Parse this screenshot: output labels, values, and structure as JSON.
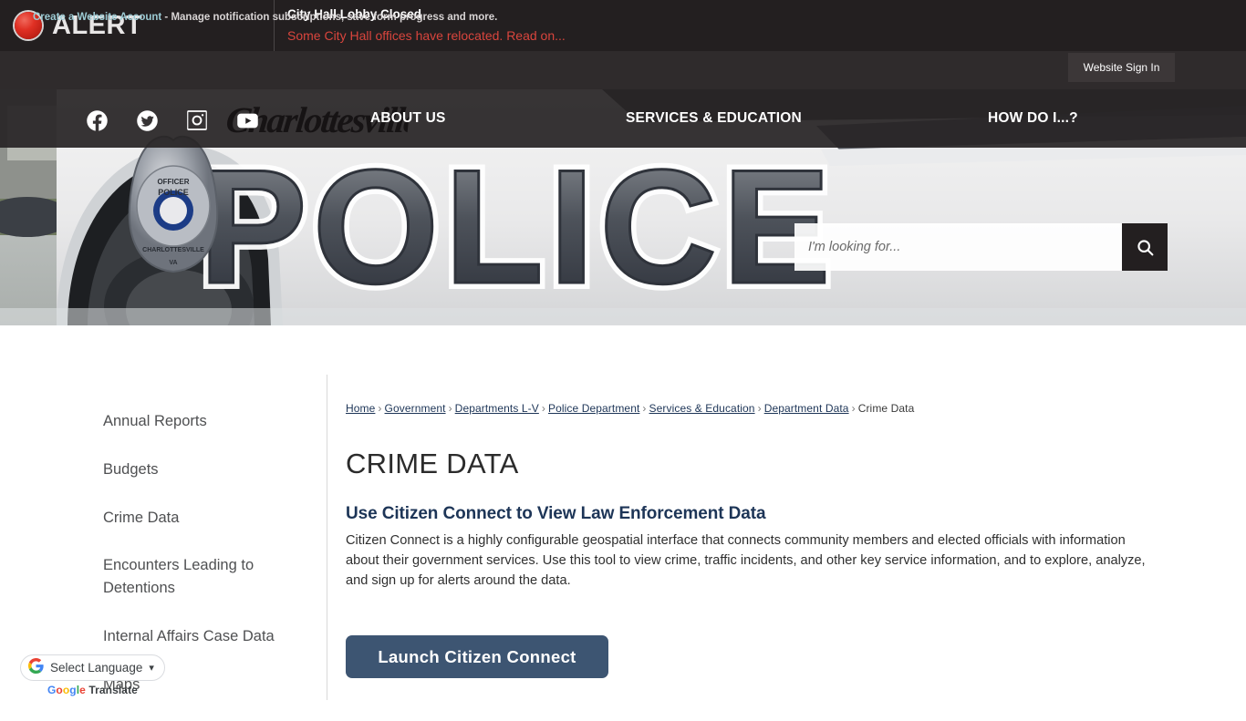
{
  "alert": {
    "badge_label": "ALERT",
    "title": "City Hall Lobby Closed",
    "link": "Some City Hall offices have relocated. Read on..."
  },
  "account_bar": {
    "link_label": "Create a Website Account",
    "description": " - Manage notification subscriptions, save form progress and more.",
    "signin_label": "Website Sign In"
  },
  "header": {
    "logo_text": "Charlottesville",
    "social": [
      {
        "name": "facebook-icon",
        "label": "Facebook"
      },
      {
        "name": "twitter-icon",
        "label": "Twitter"
      },
      {
        "name": "instagram-icon",
        "label": "Instagram"
      },
      {
        "name": "youtube-icon",
        "label": "YouTube"
      }
    ],
    "nav": [
      {
        "label": "ABOUT US"
      },
      {
        "label": "SERVICES & EDUCATION"
      },
      {
        "label": "HOW DO I...?"
      }
    ]
  },
  "search": {
    "placeholder": "I'm looking for...",
    "value": "",
    "button_icon": "search-icon"
  },
  "sidebar": {
    "items": [
      {
        "label": "Annual Reports"
      },
      {
        "label": "Budgets"
      },
      {
        "label": "Crime Data"
      },
      {
        "label": "Encounters Leading to Detentions"
      },
      {
        "label": "Internal Affairs Case Data"
      },
      {
        "label": "Maps"
      }
    ]
  },
  "breadcrumb": {
    "items": [
      {
        "label": "Home",
        "link": true
      },
      {
        "label": "Government",
        "link": true
      },
      {
        "label": "Departments L-V",
        "link": true
      },
      {
        "label": "Police Department",
        "link": true
      },
      {
        "label": "Services & Education",
        "link": true
      },
      {
        "label": "Department Data",
        "link": true
      },
      {
        "label": "Crime Data",
        "link": false
      }
    ],
    "separator": "›"
  },
  "main": {
    "title": "CRIME DATA",
    "sub_heading": "Use Citizen Connect to View Law Enforcement Data",
    "paragraph": "Citizen Connect is a highly configurable geospatial interface that connects community members and elected officials with information about their government services. Use this tool to view crime, traffic incidents, and other key service information, and to explore, analyze, and sign up for alerts around the data.",
    "cta_label": "Launch Citizen Connect"
  },
  "translate": {
    "g_letter": "G",
    "select_label": "Select Language",
    "caret": "⌄",
    "brand_google": "Google",
    "brand_translate": "Translate"
  },
  "colors": {
    "alert_bg": "#231f20",
    "alert_link": "#d9453d",
    "account_bg": "#2f2b2c",
    "nav_bg": "#282526",
    "accent_blue": "#1d3557",
    "cta_bg": "#3d5572",
    "search_btn_bg": "#231f20"
  }
}
